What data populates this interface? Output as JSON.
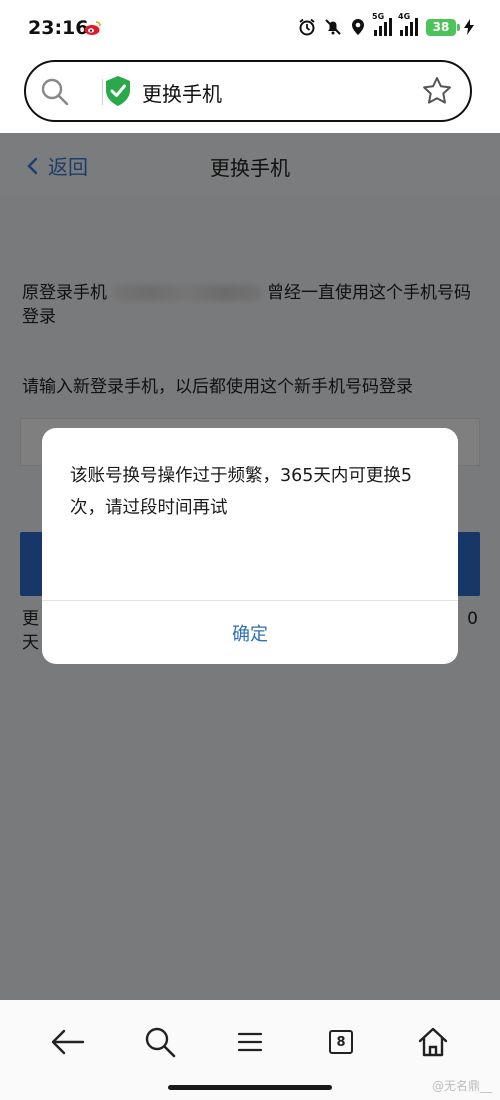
{
  "status_bar": {
    "time": "23:16",
    "app_notification_icon": "weibo-icon",
    "network_1": "5G",
    "network_2": "4G",
    "battery": "38",
    "icons": [
      "alarm-icon",
      "mute-icon",
      "location-icon",
      "signal-icon",
      "signal-icon",
      "battery-icon",
      "charging-icon"
    ]
  },
  "browser": {
    "url_title": "更换手机",
    "search_icon": "search-icon",
    "secure_icon": "shield-check-icon",
    "bookmark_icon": "star-icon"
  },
  "page": {
    "back_label": "返回",
    "title": "更换手机",
    "description_prefix": "原登录手机",
    "description_suffix": "曾经一直使用这个手机号码登录",
    "input_prompt": "请输入新登录手机，以后都使用这个新手机号码登录",
    "footer_left": "更\n天",
    "footer_right": "0"
  },
  "dialog": {
    "message": "该账号换号操作过于频繁，365天内可更换5次，请过段时间再试",
    "confirm_label": "确定",
    "accent_color": "#2f6fb8"
  },
  "bottom_bar": {
    "tabs_count": "8",
    "icons": [
      "back-arrow-icon",
      "search-icon",
      "menu-icon",
      "tabs-icon",
      "home-icon"
    ]
  },
  "watermark": "@无名鼎__"
}
